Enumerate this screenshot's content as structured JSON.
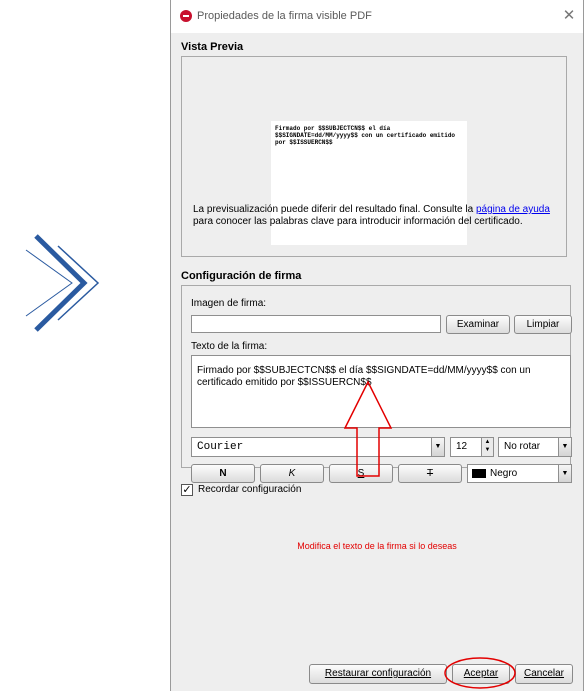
{
  "window": {
    "title": "Propiedades de la firma visible PDF",
    "close_glyph": "✕"
  },
  "preview": {
    "section_title": "Vista Previa",
    "sample_text": "Firmado por $$SUBJECTCN$$ el día $$SIGNDATE=dd/MM/yyyy$$ con un certificado emitido por $$ISSUERCN$$",
    "note_before_link": "La previsualización puede diferir del resultado final. Consulte la ",
    "note_link": "página de ayuda",
    "note_after_link": " para conocer las palabras clave para introducir información del certificado."
  },
  "config": {
    "section_title": "Configuración de firma",
    "image_label": "Imagen de firma:",
    "image_value": "",
    "browse_button": "Examinar",
    "clear_button": "Limpiar",
    "text_label": "Texto de la firma:",
    "text_value": "Firmado por $$SUBJECTCN$$ el día $$SIGNDATE=dd/MM/yyyy$$ con un certificado emitido por $$ISSUERCN$$",
    "font_family": "Courier",
    "font_size": "12",
    "rotation": "No rotar",
    "bold_button": "N",
    "italic_button": "K",
    "underline_button": "S",
    "strike_button": "T",
    "color": "Negro"
  },
  "remember": {
    "checked": true,
    "label": "Recordar configuración"
  },
  "hint_text": "Modifica el texto de la firma si lo deseas",
  "footer": {
    "restore_button": "Restaurar configuración",
    "accept_button": "Aceptar",
    "cancel_button": "Cancelar"
  },
  "colors": {
    "annotation_red": "#e30000",
    "chevron_blue": "#2a5aa0",
    "brand_red": "#c8102e"
  },
  "icons": {
    "decoration": "double-chevron-right-icon",
    "window": "app-logo-icon",
    "close": "close-icon",
    "check": "checkmark-icon"
  }
}
